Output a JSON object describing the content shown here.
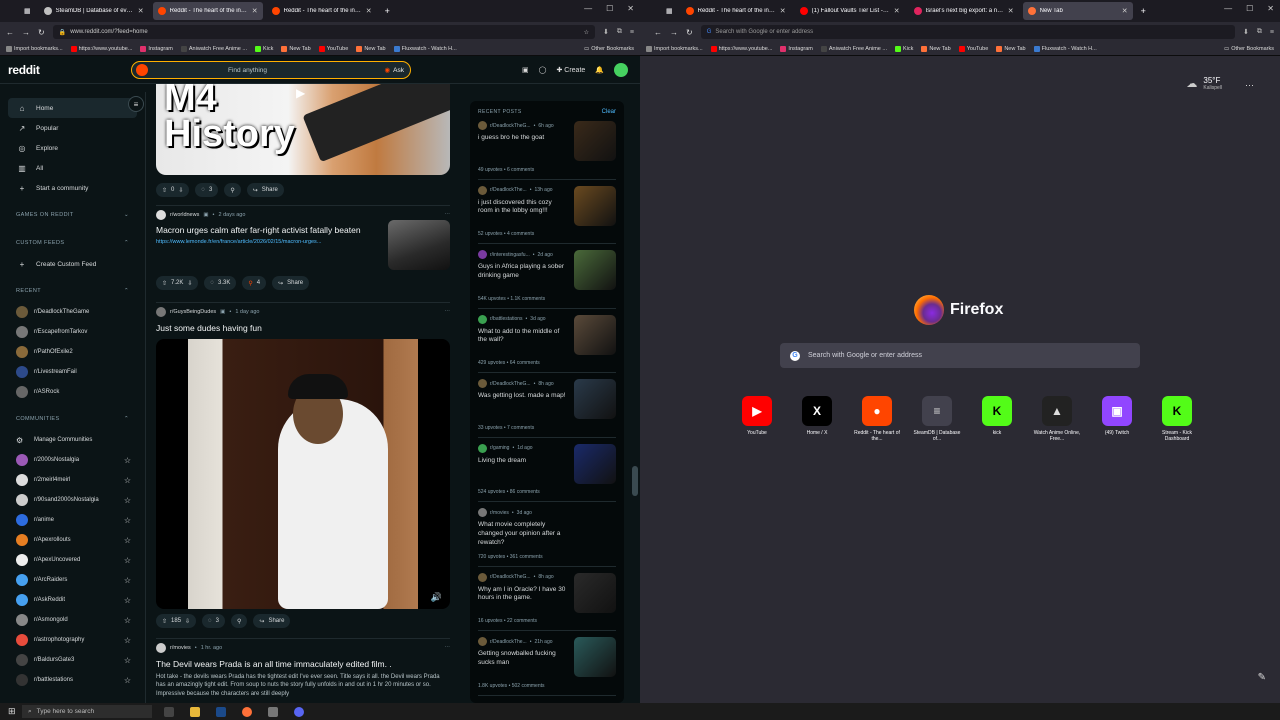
{
  "left_window": {
    "tabs": [
      {
        "label": "SteamDB | Database of everything...",
        "active": false,
        "color": "#c0c0c0"
      },
      {
        "label": "Reddit - The heart of the internet",
        "active": true,
        "color": "#ff4500"
      },
      {
        "label": "Reddit - The heart of the internet",
        "active": false,
        "color": "#ff4500"
      }
    ],
    "url": "www.reddit.com/?feed=home",
    "bookmarks": [
      "Import bookmarks...",
      "https://www.youtube...",
      "Instagram",
      "Aniwatch Free Anime ...",
      "Kick",
      "New Tab",
      "YouTube",
      "New Tab",
      "Fluxwatch - Watch H..."
    ],
    "other_bookmarks": "Other Bookmarks"
  },
  "reddit": {
    "logo": "reddit",
    "search_placeholder": "Find anything",
    "ask_label": "Ask",
    "create_label": "Create",
    "nav": [
      {
        "label": "Home",
        "icon": "home-icon",
        "glyph": "⌂"
      },
      {
        "label": "Popular",
        "icon": "popular-icon",
        "glyph": "↗"
      },
      {
        "label": "Explore",
        "icon": "explore-icon",
        "glyph": "◎"
      },
      {
        "label": "All",
        "icon": "all-icon",
        "glyph": "▥"
      },
      {
        "label": "Start a community",
        "icon": "plus-icon",
        "glyph": "+"
      }
    ],
    "games_header": "GAMES ON REDDIT",
    "custom_feeds_header": "CUSTOM FEEDS",
    "create_custom_feed": "Create Custom Feed",
    "recent_header": "RECENT",
    "recent": [
      {
        "name": "r/DeadlockTheGame",
        "color": "#6b5a3a"
      },
      {
        "name": "r/EscapefromTarkov",
        "color": "#777"
      },
      {
        "name": "r/PathOfExile2",
        "color": "#8a6a3a"
      },
      {
        "name": "r/LivestreamFail",
        "color": "#2d4a8a"
      },
      {
        "name": "r/ASRock",
        "color": "#666"
      }
    ],
    "communities_header": "COMMUNITIES",
    "manage_communities": "Manage Communities",
    "communities": [
      {
        "name": "r/2000sNostalgia",
        "color": "#9b59b6"
      },
      {
        "name": "r/2meirl4meirl",
        "color": "#ddd"
      },
      {
        "name": "r/90sand2000sNostalgia",
        "color": "#ccc"
      },
      {
        "name": "r/anime",
        "color": "#2d6cdf"
      },
      {
        "name": "r/Apexrollouts",
        "color": "#e67e22"
      },
      {
        "name": "r/ApexUncovered",
        "color": "#eee"
      },
      {
        "name": "r/ArcRaiders",
        "color": "#46a0f0"
      },
      {
        "name": "r/AskReddit",
        "color": "#46a0f0"
      },
      {
        "name": "r/Asmongold",
        "color": "#888"
      },
      {
        "name": "r/astrophotography",
        "color": "#e74c3c"
      },
      {
        "name": "r/BaldursGate3",
        "color": "#444"
      },
      {
        "name": "r/battlestations",
        "color": "#333"
      }
    ],
    "feed": {
      "video_title_text": "M4 History",
      "post0": {
        "upvotes": "0",
        "comments": "3",
        "share": "Share"
      },
      "post1": {
        "sub": "r/worldnews",
        "age": "2 days ago",
        "title": "Macron urges calm after far-right activist fatally beaten",
        "link": "https://www.lemonde.fr/en/france/article/2026/02/15/macron-urges...",
        "upvotes": "7.2K",
        "comments": "3.3K",
        "awards": "4",
        "share": "Share"
      },
      "post2": {
        "sub": "r/GuysBeingDudes",
        "age": "1 day ago",
        "title": "Just some dudes having fun",
        "upvotes": "185",
        "comments": "3",
        "share": "Share"
      },
      "post3": {
        "sub": "r/movies",
        "age": "1 hr. ago",
        "title": "The Devil wears Prada is an all time immaculately edited film. .",
        "body": "Hot take - the devils wears Prada has the tightest edit I've ever seen. Title says it all. the Devil wears Prada has an amazingly tight edit. From soup to nuts the story fully unfolds in and out in 1 hr 20 minutes or so. Impressive because the characters are still deeply"
      }
    },
    "recent_posts_header": "RECENT POSTS",
    "clear_label": "Clear",
    "recent_posts": [
      {
        "sub": "r/DeadlockTheG...",
        "age": "6h ago",
        "title": "i guess bro he the goat",
        "upvotes": "49 upvotes",
        "comments": "6 comments",
        "thumb": "#3a2a1a",
        "av": "#6b5a3a"
      },
      {
        "sub": "r/DeadlockThe...",
        "age": "13h ago",
        "title": "i just discovered this cozy room in the lobby omg!!!",
        "upvotes": "52 upvotes",
        "comments": "4 comments",
        "thumb": "#6a4a20",
        "av": "#6b5a3a"
      },
      {
        "sub": "r/interestingasfu...",
        "age": "2d ago",
        "title": "Guys in Africa playing a sober drinking game",
        "upvotes": "54K upvotes",
        "comments": "1.1K comments",
        "thumb": "#4a6a3a",
        "av": "#7a3aa0"
      },
      {
        "sub": "r/battlestations",
        "age": "3d ago",
        "title": "What to add to the middle of the wall?",
        "upvotes": "429 upvotes",
        "comments": "64 comments",
        "thumb": "#5a4a3a",
        "av": "#3aa050"
      },
      {
        "sub": "r/DeadlockTheG...",
        "age": "8h ago",
        "title": "Was getting lost. made a map!",
        "upvotes": "33 upvotes",
        "comments": "7 comments",
        "thumb": "#2a3a4a",
        "av": "#6b5a3a"
      },
      {
        "sub": "r/gaming",
        "age": "1d ago",
        "title": "Living the dream",
        "upvotes": "524 upvotes",
        "comments": "86 comments",
        "thumb": "#1a2a6a",
        "av": "#3aa050"
      },
      {
        "sub": "r/movies",
        "age": "3d ago",
        "title": "What movie completely changed your opinion after a rewatch?",
        "upvotes": "720 upvotes",
        "comments": "361 comments",
        "thumb": "",
        "av": "#777"
      },
      {
        "sub": "r/DeadlockTheG...",
        "age": "8h ago",
        "title": "Why am I in Oracle? I have 30 hours in the game.",
        "upvotes": "16 upvotes",
        "comments": "22 comments",
        "thumb": "#2a2a2a",
        "av": "#6b5a3a"
      },
      {
        "sub": "r/DeadlockThe...",
        "age": "21h ago",
        "title": "Getting snowballed fucking sucks man",
        "upvotes": "1.8K upvotes",
        "comments": "502 comments",
        "thumb": "#2a5a5a",
        "av": "#6b5a3a"
      }
    ]
  },
  "right_window": {
    "tabs": [
      {
        "label": "Reddit - The heart of the intern...",
        "active": false,
        "color": "#ff4500"
      },
      {
        "label": "(1) Fallout Vaults Tier List - You...",
        "active": false,
        "color": "#ff0000"
      },
      {
        "label": "Israel's next big export: a new c...",
        "active": false,
        "color": "#e0245e"
      },
      {
        "label": "New Tab",
        "active": true,
        "color": "#ff7139"
      }
    ],
    "url_placeholder": "Search with Google or enter address",
    "bookmarks": [
      "Import bookmarks...",
      "https://www.youtube...",
      "Instagram",
      "Aniwatch Free Anime ...",
      "Kick",
      "New Tab",
      "YouTube",
      "New Tab",
      "Fluxwatch - Watch H..."
    ],
    "other_bookmarks": "Other Bookmarks",
    "weather_temp": "35°F",
    "weather_city": "Kalispell",
    "brand": "Firefox",
    "search_placeholder": "Search with Google or enter address",
    "shortcuts": [
      {
        "label": "YouTube",
        "glyph": "▶",
        "color": "#ff0000",
        "fg": "#fff"
      },
      {
        "label": "Home / X",
        "glyph": "X",
        "color": "#000",
        "fg": "#fff"
      },
      {
        "label": "Reddit - The heart of the...",
        "glyph": "●",
        "color": "#ff4500",
        "fg": "#fff"
      },
      {
        "label": "SteamDB | Database of...",
        "glyph": "≡",
        "color": "#42414d",
        "fg": "#ddd"
      },
      {
        "label": "kick",
        "glyph": "K",
        "color": "#53fc18",
        "fg": "#000"
      },
      {
        "label": "Watch Anime Online, Free...",
        "glyph": "▲",
        "color": "#222",
        "fg": "#ddd"
      },
      {
        "label": "(49) Twitch",
        "glyph": "▣",
        "color": "#9146ff",
        "fg": "#fff"
      },
      {
        "label": "Stream - Kick Dashboard",
        "glyph": "K",
        "color": "#53fc18",
        "fg": "#000"
      }
    ]
  },
  "taskbar": {
    "search_placeholder": "Type here to search"
  }
}
